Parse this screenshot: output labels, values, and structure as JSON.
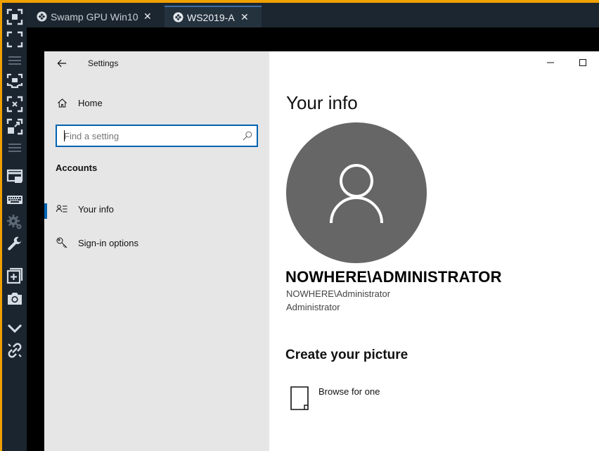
{
  "toolbar": {
    "buttons": [
      {
        "icon": "select-region-icon"
      },
      {
        "icon": "fullscreen-icon"
      },
      {
        "icon": "menu-lines-icon"
      },
      {
        "icon": "fit-to-screen-icon"
      },
      {
        "icon": "scale-icon"
      },
      {
        "icon": "resize-icon"
      },
      {
        "icon": "menu-lines-icon"
      },
      {
        "icon": "window-icon"
      },
      {
        "icon": "keyboard-icon"
      },
      {
        "icon": "gears-icon"
      },
      {
        "icon": "wrench-icon"
      },
      {
        "icon": "new-session-icon"
      },
      {
        "icon": "camera-icon"
      },
      {
        "icon": "chevron-down-icon"
      },
      {
        "icon": "link-icon"
      }
    ]
  },
  "tabs": [
    {
      "label": "Swamp GPU Win10",
      "active": false,
      "close": "✕"
    },
    {
      "label": "WS2019-A",
      "active": true,
      "close": "✕"
    }
  ],
  "settings": {
    "app_title": "Settings",
    "home_label": "Home",
    "search_placeholder": "Find a setting",
    "section_heading": "Accounts",
    "nav": [
      {
        "label": "Your info",
        "icon": "user-info-icon",
        "selected": true
      },
      {
        "label": "Sign-in options",
        "icon": "key-icon",
        "selected": false
      }
    ],
    "page_title": "Your info",
    "user_name": "NOWHERE\\ADMINISTRATOR",
    "user_account": "NOWHERE\\Administrator",
    "user_role": "Administrator",
    "create_heading": "Create your picture",
    "browse_label": "Browse for one"
  },
  "colors": {
    "accent": "#0063b1",
    "border_accent": "#f0a000",
    "avatar_bg": "#666666",
    "side_panel_bg": "#e6e6e6"
  }
}
